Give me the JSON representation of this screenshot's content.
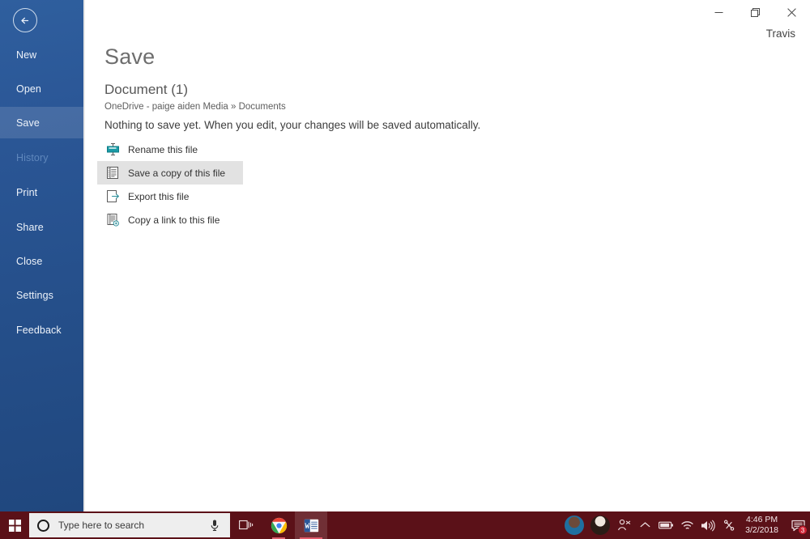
{
  "window": {
    "username": "Travis",
    "controls": [
      {
        "name": "minimize",
        "glyph": "minimize-icon"
      },
      {
        "name": "restore",
        "glyph": "restore-icon"
      },
      {
        "name": "close",
        "glyph": "close-icon"
      }
    ]
  },
  "sidebar": {
    "back_label": "Back",
    "items": [
      {
        "label": "New",
        "state": "normal"
      },
      {
        "label": "Open",
        "state": "normal"
      },
      {
        "label": "Save",
        "state": "selected"
      },
      {
        "label": "History",
        "state": "disabled"
      },
      {
        "label": "Print",
        "state": "normal"
      },
      {
        "label": "Share",
        "state": "normal"
      },
      {
        "label": "Close",
        "state": "normal"
      },
      {
        "label": "Settings",
        "state": "normal"
      },
      {
        "label": "Feedback",
        "state": "normal"
      }
    ],
    "accent_color": "#2b5797",
    "selected_color": "#3d6cab"
  },
  "main": {
    "page_title": "Save",
    "document_name": "Document (1)",
    "document_path": "OneDrive - paige aiden Media » Documents",
    "status_note": "Nothing to save yet. When you edit, your changes will be saved automatically.",
    "actions": [
      {
        "label": "Rename this file",
        "icon": "rename-file-icon",
        "highlighted": false
      },
      {
        "label": "Save a copy of this file",
        "icon": "save-copy-icon",
        "highlighted": true
      },
      {
        "label": "Export this file",
        "icon": "export-file-icon",
        "highlighted": false
      },
      {
        "label": "Copy a link to this file",
        "icon": "copy-link-icon",
        "highlighted": false
      }
    ],
    "highlight_color": "#e2e2e2"
  },
  "taskbar": {
    "background_color": "#5b1118",
    "start_label": "Start",
    "search_placeholder": "Type here to search",
    "mic_label": "Cortana microphone",
    "buttons": [
      {
        "name": "task-view",
        "label": "Task View"
      },
      {
        "name": "chrome",
        "label": "Google Chrome"
      },
      {
        "name": "word",
        "label": "Microsoft Word"
      }
    ],
    "tray": {
      "people_label": "People",
      "show_hidden_label": "Show hidden icons",
      "battery_label": "Battery",
      "network_label": "Network",
      "volume_label": "Volume",
      "bluetooth_label": "Bluetooth",
      "time": "4:46 PM",
      "date": "3/2/2018",
      "notification_count": "3"
    }
  }
}
